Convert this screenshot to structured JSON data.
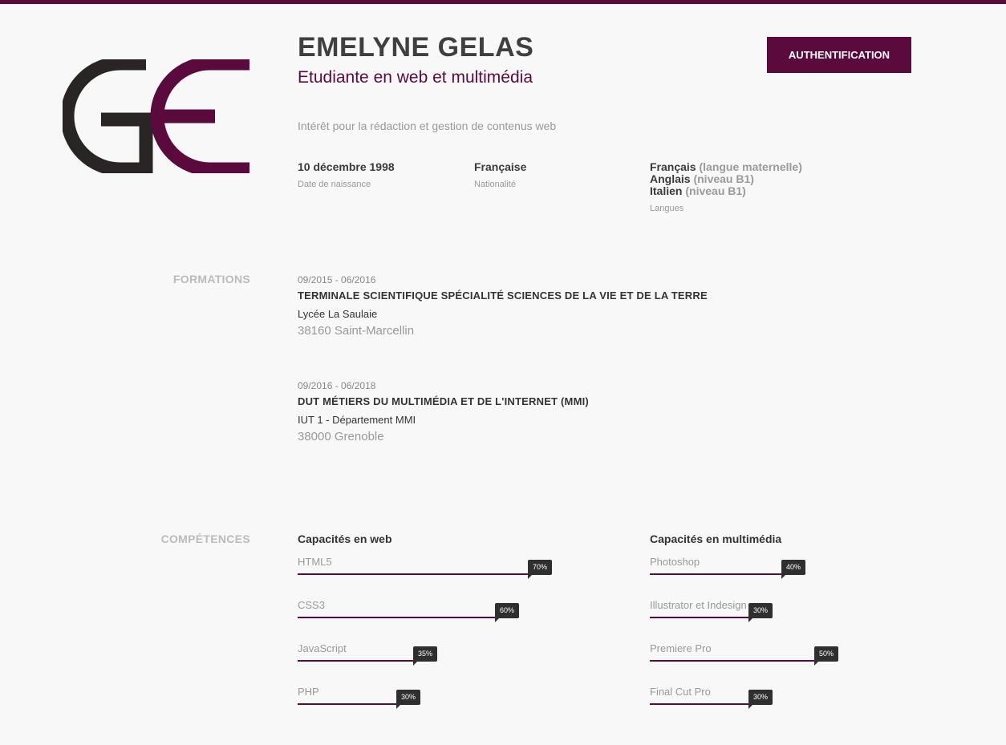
{
  "colors": {
    "accent": "#5b0a3d",
    "logo_dark": "#2a2525",
    "text_dark": "#3f3f3f",
    "text_muted": "#999999",
    "badge_bg": "#2f2f2f",
    "background": "#f8f8f8"
  },
  "header": {
    "logo_icon": "ge-monogram-logo",
    "name": "EMELYNE GELAS",
    "subtitle": "Etudiante en web et multimédia",
    "auth_button_label": "AUTHENTIFICATION",
    "interest": "Intérêt pour la rédaction et gestion de contenus web"
  },
  "info": {
    "birth": {
      "value": "10 décembre 1998",
      "label": "Date de naissance"
    },
    "nationality": {
      "value": "Française",
      "label": "Nationalité"
    },
    "languages": {
      "items": [
        {
          "name": "Français",
          "level": "(langue maternelle)"
        },
        {
          "name": "Anglais",
          "level": "(niveau B1)"
        },
        {
          "name": "Italien",
          "level": "(niveau B1)"
        }
      ],
      "label": "Langues"
    }
  },
  "formations": {
    "section_title": "FORMATIONS",
    "items": [
      {
        "date": "09/2015 - 06/2016",
        "title": "TERMINALE SCIENTIFIQUE SPÉCIALITÉ SCIENCES DE LA VIE ET DE LA TERRE",
        "school": "Lycée La Saulaie",
        "city": "38160 Saint-Marcellin"
      },
      {
        "date": "09/2016 - 06/2018",
        "title": "DUT MÉTIERS DU MULTIMÉDIA ET DE L'INTERNET (MMI)",
        "school": "IUT 1 - Département MMI",
        "city": "38000 Grenoble"
      }
    ]
  },
  "competences": {
    "section_title": "COMPÉTENCES",
    "web": {
      "title": "Capacités en web",
      "skills": [
        {
          "name": "HTML5",
          "percent_label": "70%",
          "level": 0.7
        },
        {
          "name": "CSS3",
          "percent_label": "60%",
          "level": 0.6
        },
        {
          "name": "JavaScript",
          "percent_label": "35%",
          "level": 0.35
        },
        {
          "name": "PHP",
          "percent_label": "30%",
          "level": 0.3
        }
      ]
    },
    "multimedia": {
      "title": "Capacités en multimédia",
      "skills": [
        {
          "name": "Photoshop",
          "percent_label": "40%",
          "level": 0.4
        },
        {
          "name": "Illustrator et Indesign",
          "percent_label": "30%",
          "level": 0.3
        },
        {
          "name": "Premiere Pro",
          "percent_label": "50%",
          "level": 0.5
        },
        {
          "name": "Final Cut Pro",
          "percent_label": "30%",
          "level": 0.3
        }
      ]
    }
  }
}
